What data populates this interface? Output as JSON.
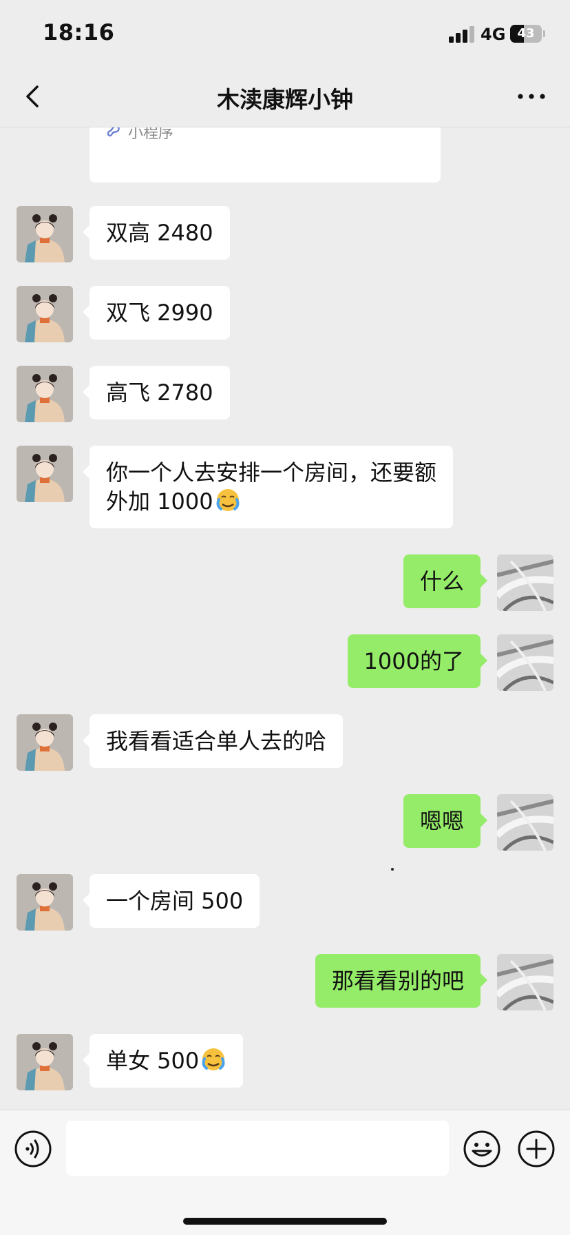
{
  "status_bar": {
    "time": "18:16",
    "network": "4G",
    "battery_level": "43",
    "battery_fraction": 0.43
  },
  "header": {
    "title": "木渎康辉小钟"
  },
  "mini_program_card": {
    "label": "小程序"
  },
  "messages": [
    {
      "side": "left",
      "text": "双高 2480"
    },
    {
      "side": "left",
      "text": "双飞 2990"
    },
    {
      "side": "left",
      "text": "高飞 2780"
    },
    {
      "side": "left",
      "text_line1": "你一个人去安排一个房间，还要额",
      "text_line2": "外加 1000",
      "emoji": "face-holding-back-tears"
    },
    {
      "side": "right",
      "text": "什么"
    },
    {
      "side": "right",
      "text": "1000的了"
    },
    {
      "side": "left",
      "text": "我看看适合单人去的哈"
    },
    {
      "side": "right",
      "text": "嗯嗯"
    },
    {
      "side": "left",
      "text": "一个房间 500"
    },
    {
      "side": "right",
      "text": "那看看别的吧"
    },
    {
      "side": "left",
      "text": "单女 500",
      "emoji": "face-holding-back-tears"
    }
  ],
  "input_bar": {
    "placeholder": ""
  },
  "colors": {
    "background": "#ededed",
    "outgoing_bubble": "#95ec69",
    "incoming_bubble": "#ffffff"
  }
}
